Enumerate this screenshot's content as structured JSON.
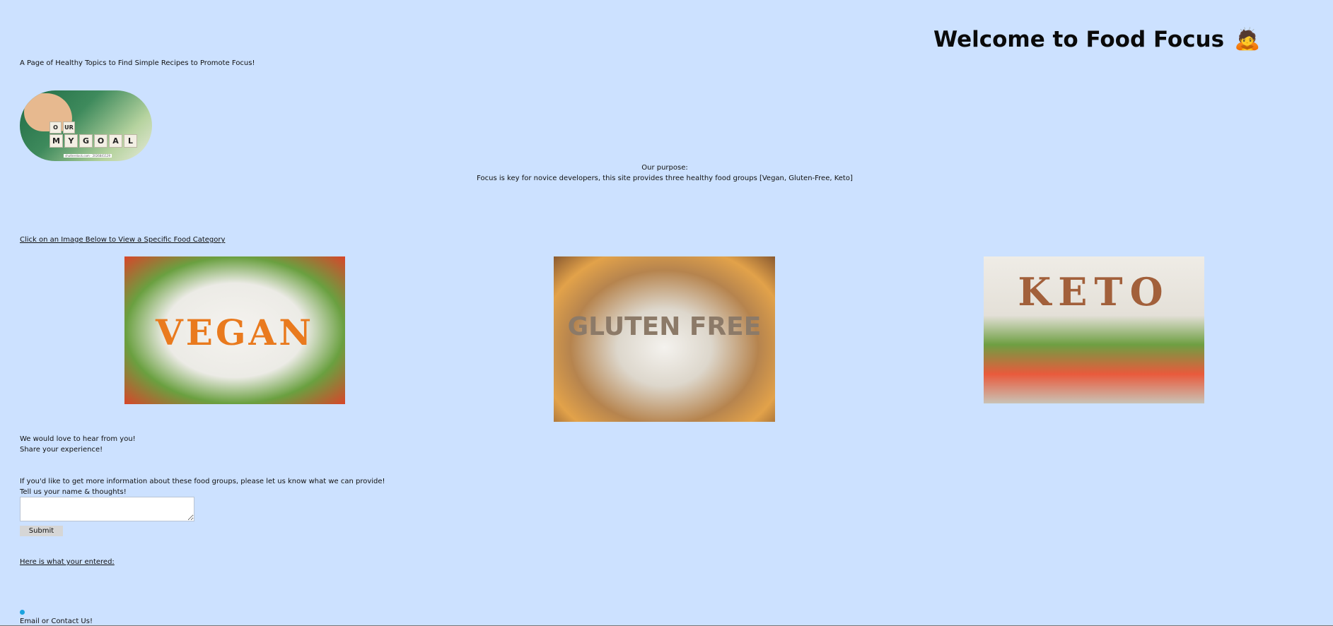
{
  "header": {
    "title": "Welcome to Food Focus",
    "title_emoji": "🙇",
    "subtitle": "A Page of Healthy Topics to Find Simple Recipes to Promote Focus!"
  },
  "goal_image": {
    "dice_top": [
      "O",
      "UR"
    ],
    "dice_bottom": [
      "M",
      "Y",
      "G",
      "O",
      "A",
      "L"
    ],
    "caption": "shutterstock.com · 2026841129"
  },
  "purpose": {
    "heading": "Our purpose:",
    "text": "Focus is key for novice developers, this site provides three healthy food groups [Vegan, Gluten-Free, Keto]"
  },
  "categories": {
    "link_text": "Click on an Image Below to View a Specific Food Category",
    "items": [
      {
        "word": "VEGAN"
      },
      {
        "word": "GLUTEN FREE"
      },
      {
        "word": "KETO"
      }
    ]
  },
  "feedback": {
    "line1": "We would love to hear from you!",
    "line2": "Share your experience!"
  },
  "info": {
    "line1": "If you'd like to get more information about these food groups, please let us know what we can provide!",
    "line2": "Tell us your name & thoughts!"
  },
  "form": {
    "textarea_value": "",
    "submit_label": "Submit"
  },
  "entered": {
    "link_text": "Here is what your entered:"
  },
  "contact": {
    "text": "Email or Contact Us!"
  },
  "colors": {
    "background": "#cce1ff",
    "bullet": "#1aa3e0"
  }
}
